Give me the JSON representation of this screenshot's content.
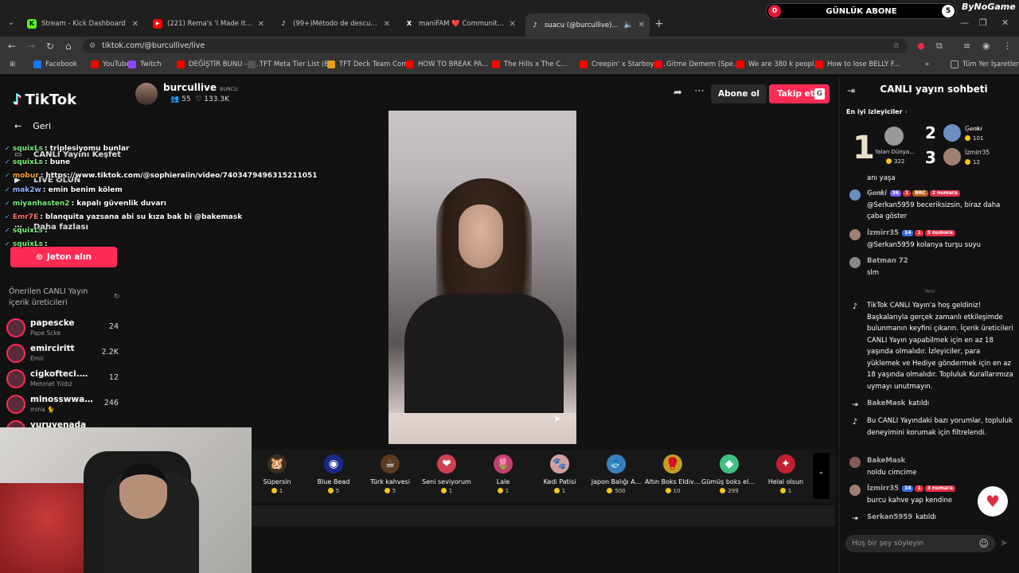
{
  "browser": {
    "tabs": [
      {
        "title": "Stream - Kick Dashboard",
        "fav": "K",
        "color": "#53fc18"
      },
      {
        "title": "(221) Rema's 'I Made It' Moment",
        "fav": "▶",
        "color": "#ff0000"
      },
      {
        "title": "(99+)Método de descuento nuevo",
        "fav": "♪",
        "color": "#000000"
      },
      {
        "title": "maniFAM ❤️ Community / X",
        "fav": "X",
        "color": "#000000"
      },
      {
        "title": "suacu (@burcullive) CANLI",
        "fav": "♪",
        "color": "#000000"
      }
    ],
    "url": "tiktok.com/@burcullive/live",
    "bookmarks": [
      "Facebook",
      "YouTube",
      "Twitch",
      "DEĞİŞTİR BUNU - Y...",
      "TFT Meta Tier List (B...",
      "TFT Deck Team Com...",
      "HOW TO BREAK PA...",
      "The Hills x The C...",
      "Creepin' x Starboy (...",
      "Gitme Demem (Spe...",
      "We are 380 k peopl...",
      "How to lose BELLY F..."
    ],
    "all_bookmarks": "Tüm Yer İşaretleri"
  },
  "overlay": {
    "sub_label": "GÜNLÜK ABONE",
    "sub_current": "0",
    "sub_goal": "5",
    "brand": "ByNoGame",
    "chat": [
      {
        "user": "squixLs",
        "text": ": triplesiyomu bunlar",
        "color": "#7cf07c"
      },
      {
        "user": "squixLs",
        "text": ": bune",
        "color": "#7cf07c"
      },
      {
        "user": "mobur",
        "text": ": https://www.tiktok.com/@sophieraiin/video/7403479496315211051",
        "color": "#ffa040"
      },
      {
        "user": "mak2w",
        "text": ": emin benim kölem",
        "color": "#8fb0ff"
      },
      {
        "user": "miyanhasten2",
        "text": ": kapalı güvenlik duvarı",
        "color": "#7cf07c"
      },
      {
        "user": "Emr7E",
        "text": ": blanquita yazsana abi su kıza bak bi @bakemask",
        "color": "#ff7070"
      },
      {
        "user": "squixLs",
        "text": ":",
        "color": "#7cf07c"
      },
      {
        "user": "squixLs",
        "text": ":",
        "color": "#7cf07c"
      }
    ]
  },
  "sidebar": {
    "logo": "TikTok",
    "back": "Geri",
    "explore": "CANLI Yayını Keşfet",
    "go_live": "LIVE OLUN",
    "more": "Daha fazlası",
    "coins_button": "Jeton alın",
    "recommended_title": "Önerilen CANLI Yayın içerik üreticileri",
    "creators": [
      {
        "name": "papescke",
        "sub": "Pape Scke",
        "count": "24"
      },
      {
        "name": "emirciritt",
        "sub": "Emir",
        "count": "2.2K"
      },
      {
        "name": "cigkofteci.m...",
        "sub": "Mehmet Yıldız",
        "count": "12"
      },
      {
        "name": "minosswwaa_",
        "sub": "mina 🐈",
        "count": "246"
      },
      {
        "name": "yuruyenada",
        "sub": "",
        "count": ""
      }
    ]
  },
  "host": {
    "name": "burcullive",
    "tag": "BURCU",
    "viewers": "55",
    "likes": "133.3K",
    "subscribe": "Abone ol",
    "follow": "Takip et",
    "follow_key": "G"
  },
  "gifts": [
    {
      "name": "Süpersin",
      "price": "1",
      "icon": "🐹",
      "bg": "#3a3020"
    },
    {
      "name": "Blue Bead",
      "price": "5",
      "icon": "◉",
      "bg": "#1a2a8a"
    },
    {
      "name": "Türk kahvesi",
      "price": "5",
      "icon": "☕",
      "bg": "#5a3a20"
    },
    {
      "name": "Seni seviyorum",
      "price": "1",
      "icon": "❤",
      "bg": "#d04050"
    },
    {
      "name": "Lale",
      "price": "1",
      "icon": "🌷",
      "bg": "#c04070"
    },
    {
      "name": "Kedi Patisi",
      "price": "1",
      "icon": "🐾",
      "bg": "#d0a0a0"
    },
    {
      "name": "Japon Balığı A...",
      "price": "500",
      "icon": "🐟",
      "bg": "#3a80c0"
    },
    {
      "name": "Altın Boks Eldive...",
      "price": "10",
      "icon": "🥊",
      "bg": "#c0a020"
    },
    {
      "name": "Gümüş boks eldi...",
      "price": "299",
      "icon": "◆",
      "bg": "#40c080"
    },
    {
      "name": "Helal olsun",
      "price": "1",
      "icon": "✦",
      "bg": "#c02030"
    }
  ],
  "chat": {
    "title": "CANLI yayın sohbeti",
    "top_viewers_label": "En iyi izleyiciler",
    "top": [
      {
        "rank": "1",
        "name": "Yalan Dünya...",
        "coins": "322"
      },
      {
        "rank": "2",
        "name": "Ģ𝒆𝒏𝒌𝒊",
        "coins": "101"
      },
      {
        "rank": "3",
        "name": "İzmirr35",
        "coins": "12"
      }
    ],
    "partial_msg": "anı yaşa",
    "messages": [
      {
        "user": "Ģ𝒆𝒏𝒌𝒊",
        "b1": "36",
        "b2": "1",
        "b3": "BRC",
        "b4": "2 numara",
        "text": "@Serkan5959 beceriksizsin, biraz daha çaba göster"
      },
      {
        "user": "İzmirr35",
        "b1": "14",
        "b2": "1",
        "b4": "3 numara",
        "text": "@Serkan5959 kolanya turşu suyu"
      },
      {
        "user": "Batman 72",
        "text": "slm"
      }
    ],
    "separator": "Yeni",
    "welcome": "TikTok CANLI Yayın'a hoş geldiniz! Başkalarıyla gerçek zamanlı etkileşimde bulunmanın keyfini çıkarın. İçerik üreticileri CANLI Yayın yapabilmek için en az 18 yaşında olmalıdır. İzleyiciler, para yüklemek ve Hediye göndermek için en az 18 yaşında olmalıdır. Topluluk Kurallarımıza uymayı unutmayın.",
    "join1_user": "BakeMask",
    "join1_text": "katıldı",
    "filter_note": "Bu CANLI Yayındaki bazı yorumlar, topluluk deneyimini korumak için filtrelendi.",
    "m4_user": "BakeMask",
    "m4_text": "noldu cimcime",
    "m5_user": "İzmirr35",
    "m5_b1": "14",
    "m5_b2": "1",
    "m5_b4": "3 numara",
    "m5_text": "burcu kahve yap kendine",
    "join2_user": "Serkan5959",
    "join2_text": "katıldı",
    "input_placeholder": "Hoş bir şey söyleyin"
  }
}
